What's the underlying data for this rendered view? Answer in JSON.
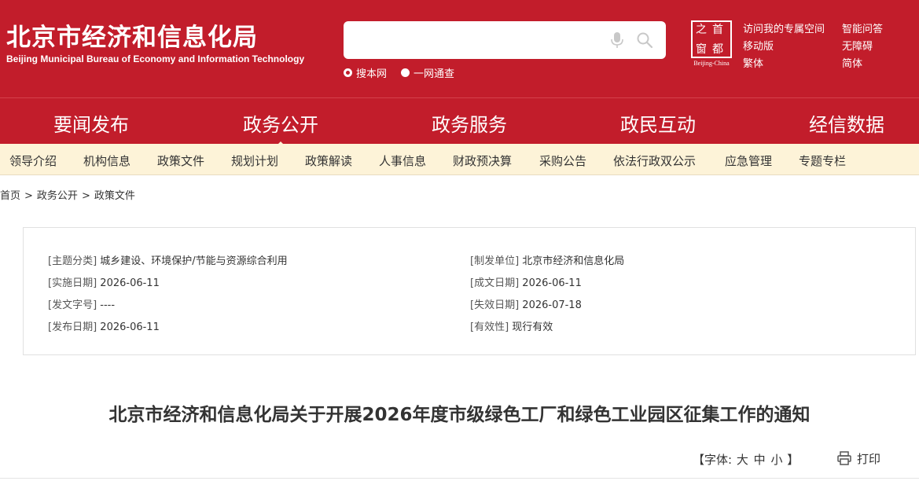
{
  "header": {
    "title": "北京市经济和信息化局",
    "subtitle": "Beijing Municipal Bureau of Economy and Information Technology",
    "search": {
      "placeholder": "",
      "value": ""
    },
    "scope": {
      "site": "搜本网",
      "all": "一网通查"
    },
    "seal": {
      "chars": [
        "首",
        "都",
        "之",
        "窗"
      ],
      "label": "Beijing-China"
    },
    "links": {
      "visit_space": "访问我的专属空间",
      "mobile": "移动版",
      "traditional": "繁体",
      "smart_qa": "智能问答",
      "accessible": "无障碍",
      "simplified": "简体"
    }
  },
  "nav_main": [
    "要闻发布",
    "政务公开",
    "政务服务",
    "政民互动",
    "经信数据"
  ],
  "nav_main_active": "政务公开",
  "nav_sub": [
    "领导介绍",
    "机构信息",
    "政策文件",
    "规划计划",
    "政策解读",
    "人事信息",
    "财政预决算",
    "采购公告",
    "依法行政双公示",
    "应急管理",
    "专题专栏"
  ],
  "breadcrumb": {
    "home": "首页",
    "level1": "政务公开",
    "level2": "政策文件",
    "separator": ">"
  },
  "meta": {
    "topic": {
      "key": "[主题分类]",
      "value": "城乡建设、环境保护/节能与资源综合利用"
    },
    "issuer": {
      "key": "[制发单位]",
      "value": "北京市经济和信息化局"
    },
    "effective_date": {
      "key": "[实施日期]",
      "value": "2026-06-11"
    },
    "written_date": {
      "key": "[成文日期]",
      "value": "2026-06-11"
    },
    "doc_number": {
      "key": "[发文字号]",
      "value": "----"
    },
    "expiry_date": {
      "key": "[失效日期]",
      "value": "2026-07-18"
    },
    "publish_date": {
      "key": "[发布日期]",
      "value": "2026-06-11"
    },
    "validity": {
      "key": "[有效性]",
      "value": "现行有效"
    }
  },
  "document": {
    "title": "北京市经济和信息化局关于开展2026年度市级绿色工厂和绿色工业园区征集工作的通知"
  },
  "tools": {
    "font_label": "【字体:",
    "font_large": "大",
    "font_medium": "中",
    "font_small": "小",
    "font_close": "】",
    "print": "打印"
  },
  "colors": {
    "brand_red": "#c21d2b",
    "subnav_bg": "#fdf3d8"
  }
}
